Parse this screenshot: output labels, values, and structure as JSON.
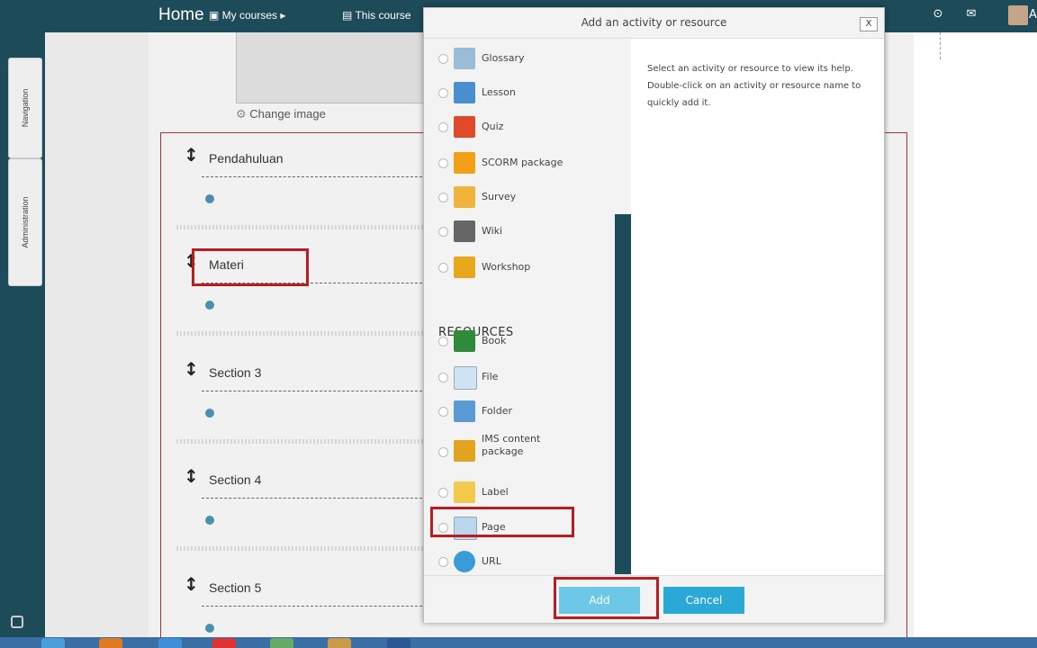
{
  "topbar": {
    "home": "Home",
    "my_courses": "My courses ▸",
    "this_course": "This course",
    "avatar_letter": "A"
  },
  "dock": {
    "navigation": "Navigation",
    "administration": "Administration"
  },
  "course": {
    "change_image": "Change image",
    "sections": [
      {
        "title": "Pendahuluan"
      },
      {
        "title": "Materi"
      },
      {
        "title": "Section 3"
      },
      {
        "title": "Section 4"
      },
      {
        "title": "Section 5"
      }
    ]
  },
  "modal": {
    "title": "Add an activity or resource",
    "close": "X",
    "help": "Select an activity or resource to view its help. Double-click on an activity or resource name to quickly add it.",
    "activities": [
      {
        "label": "Glossary",
        "icon": "glossary-icon",
        "color": "#9bbcd9"
      },
      {
        "label": "Lesson",
        "icon": "lesson-icon",
        "color": "#4b8fd0"
      },
      {
        "label": "Quiz",
        "icon": "quiz-icon",
        "color": "#e04a2a"
      },
      {
        "label": "SCORM package",
        "icon": "scorm-icon",
        "color": "#f2a017"
      },
      {
        "label": "Survey",
        "icon": "survey-icon",
        "color": "#f0b43a"
      },
      {
        "label": "Wiki",
        "icon": "wiki-icon",
        "color": "#666666"
      },
      {
        "label": "Workshop",
        "icon": "workshop-icon",
        "color": "#e8a81c"
      }
    ],
    "resources_heading": "RESOURCES",
    "resources": [
      {
        "label": "Book",
        "icon": "book-icon",
        "color": "#2e8b3a"
      },
      {
        "label": "File",
        "icon": "file-icon",
        "color": "#cfe3f3"
      },
      {
        "label": "Folder",
        "icon": "folder-icon",
        "color": "#5b9bd5"
      },
      {
        "label": "IMS content package",
        "icon": "ims-icon",
        "color": "#e2a31e"
      },
      {
        "label": "Label",
        "icon": "label-icon",
        "color": "#f2c94c"
      },
      {
        "label": "Page",
        "icon": "page-icon",
        "color": "#bcd6ee"
      },
      {
        "label": "URL",
        "icon": "url-icon",
        "color": "#3b9bd8"
      }
    ],
    "add": "Add",
    "cancel": "Cancel"
  }
}
